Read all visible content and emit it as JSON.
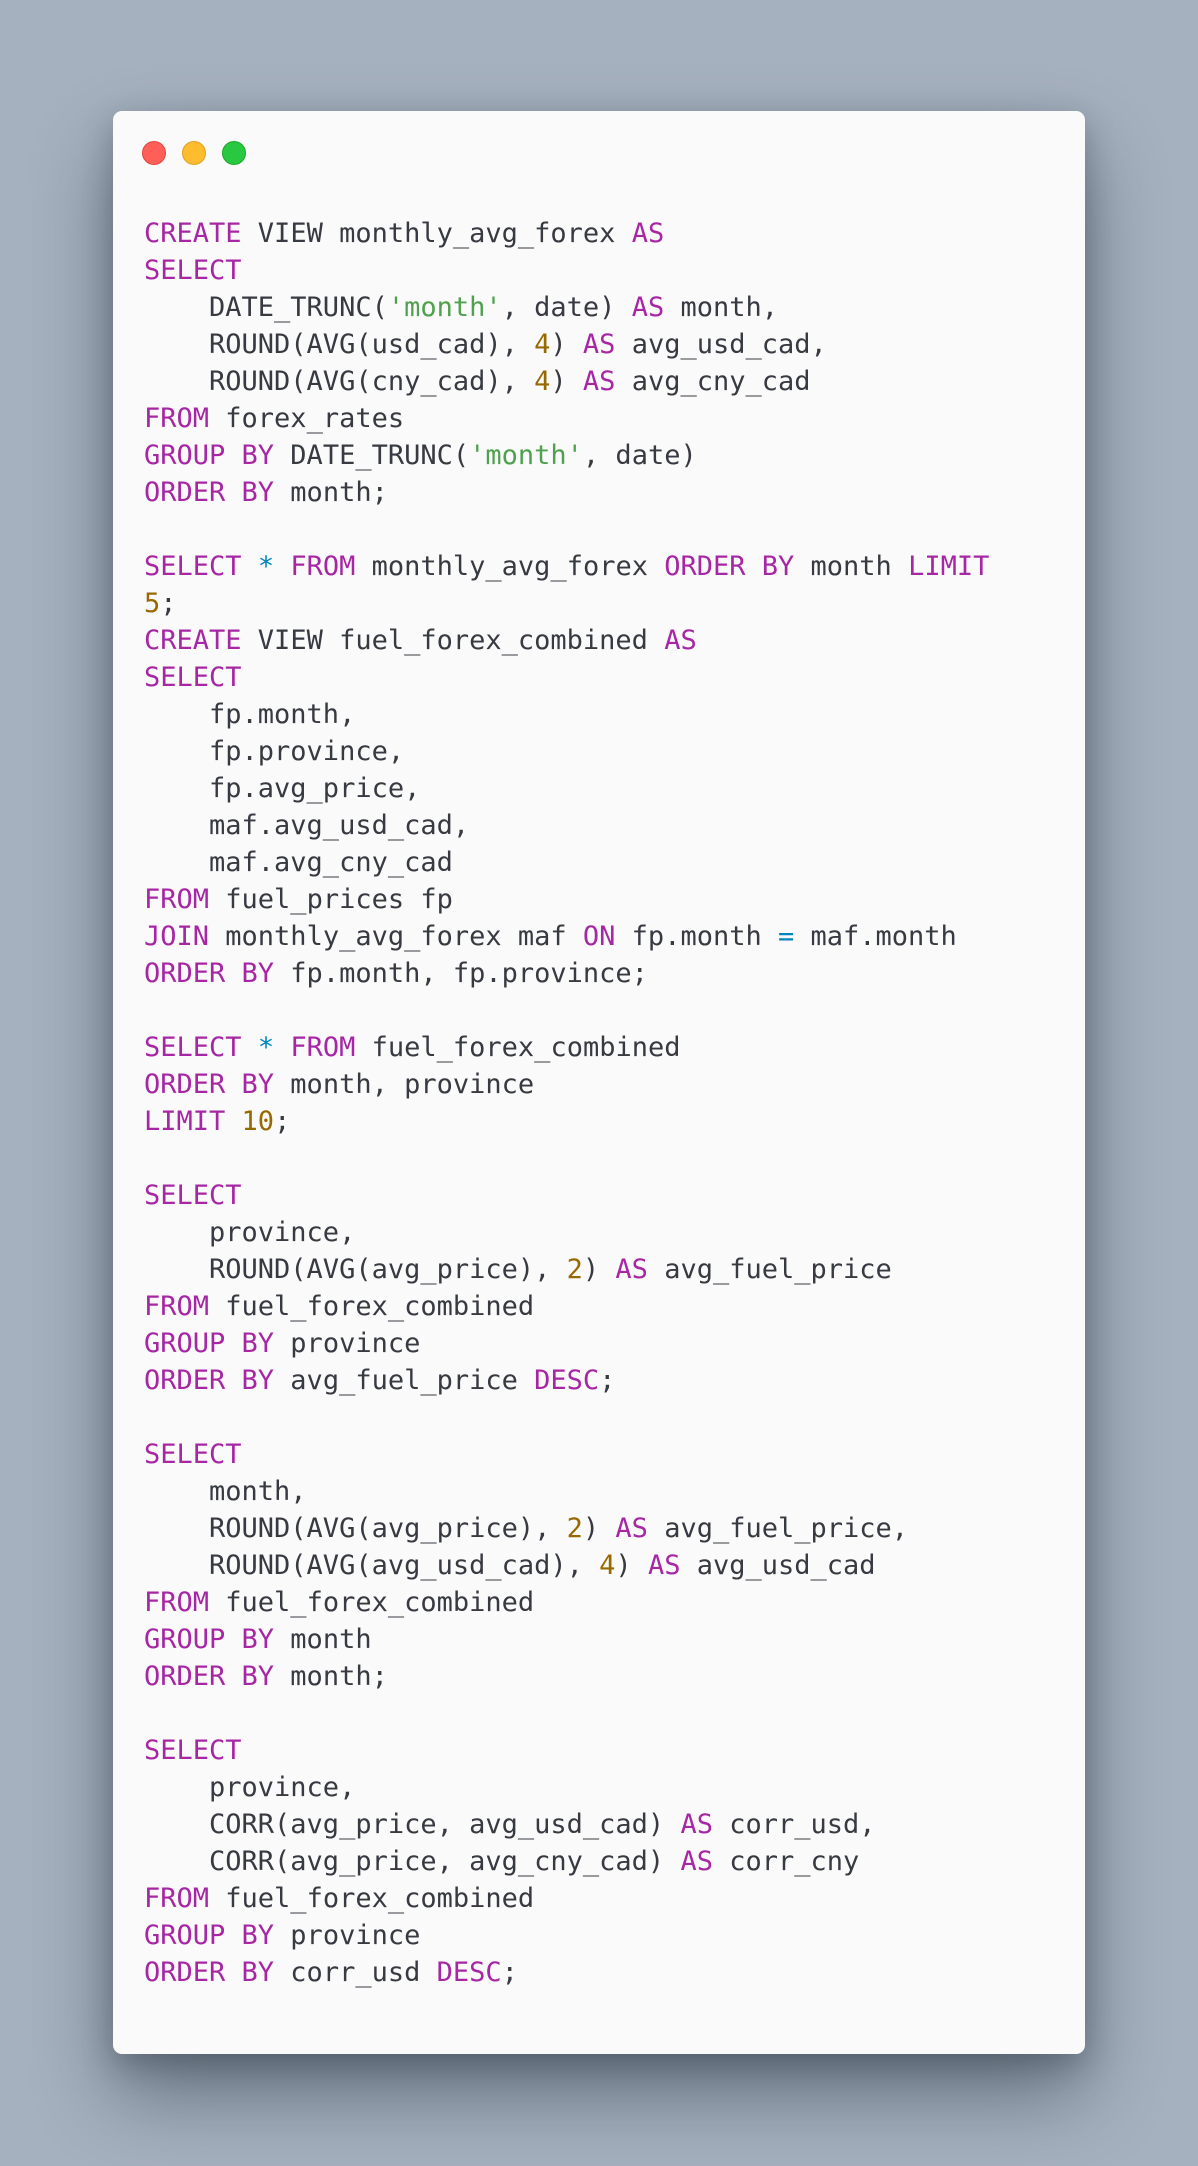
{
  "window": {
    "controls": {
      "close": "red-dot-icon",
      "minimize": "yellow-dot-icon",
      "zoom": "green-dot-icon"
    }
  },
  "theme": {
    "background": "#a6b1bf",
    "panel": "#fafafa",
    "keyword": "#a626a4",
    "string": "#50a14f",
    "number": "#986801",
    "operator": "#0184bc",
    "text": "#383a42"
  },
  "code": {
    "language": "SQL",
    "lines": [
      [
        [
          "kw",
          "CREATE"
        ],
        [
          "id",
          " VIEW monthly_avg_forex "
        ],
        [
          "kw",
          "AS"
        ]
      ],
      [
        [
          "kw",
          "SELECT"
        ]
      ],
      [
        [
          "id",
          "    DATE_TRUNC("
        ],
        [
          "str",
          "'month'"
        ],
        [
          "id",
          ", date) "
        ],
        [
          "kw",
          "AS"
        ],
        [
          "id",
          " month,"
        ]
      ],
      [
        [
          "id",
          "    ROUND(AVG(usd_cad), "
        ],
        [
          "num",
          "4"
        ],
        [
          "id",
          ") "
        ],
        [
          "kw",
          "AS"
        ],
        [
          "id",
          " avg_usd_cad,"
        ]
      ],
      [
        [
          "id",
          "    ROUND(AVG(cny_cad), "
        ],
        [
          "num",
          "4"
        ],
        [
          "id",
          ") "
        ],
        [
          "kw",
          "AS"
        ],
        [
          "id",
          " avg_cny_cad"
        ]
      ],
      [
        [
          "kw",
          "FROM"
        ],
        [
          "id",
          " forex_rates"
        ]
      ],
      [
        [
          "kw",
          "GROUP BY"
        ],
        [
          "id",
          " DATE_TRUNC("
        ],
        [
          "str",
          "'month'"
        ],
        [
          "id",
          ", date)"
        ]
      ],
      [
        [
          "kw",
          "ORDER BY"
        ],
        [
          "id",
          " month;"
        ]
      ],
      [],
      [
        [
          "kw",
          "SELECT"
        ],
        [
          "id",
          " "
        ],
        [
          "op",
          "*"
        ],
        [
          "id",
          " "
        ],
        [
          "kw",
          "FROM"
        ],
        [
          "id",
          " monthly_avg_forex "
        ],
        [
          "kw",
          "ORDER BY"
        ],
        [
          "id",
          " month "
        ],
        [
          "kw",
          "LIMIT"
        ]
      ],
      [
        [
          "num",
          "5"
        ],
        [
          "id",
          ";"
        ]
      ],
      [
        [
          "kw",
          "CREATE"
        ],
        [
          "id",
          " VIEW fuel_forex_combined "
        ],
        [
          "kw",
          "AS"
        ]
      ],
      [
        [
          "kw",
          "SELECT"
        ]
      ],
      [
        [
          "id",
          "    fp.month,"
        ]
      ],
      [
        [
          "id",
          "    fp.province,"
        ]
      ],
      [
        [
          "id",
          "    fp.avg_price,"
        ]
      ],
      [
        [
          "id",
          "    maf.avg_usd_cad,"
        ]
      ],
      [
        [
          "id",
          "    maf.avg_cny_cad"
        ]
      ],
      [
        [
          "kw",
          "FROM"
        ],
        [
          "id",
          " fuel_prices fp"
        ]
      ],
      [
        [
          "kw",
          "JOIN"
        ],
        [
          "id",
          " monthly_avg_forex maf "
        ],
        [
          "kw",
          "ON"
        ],
        [
          "id",
          " fp.month "
        ],
        [
          "op",
          "="
        ],
        [
          "id",
          " maf.month"
        ]
      ],
      [
        [
          "kw",
          "ORDER BY"
        ],
        [
          "id",
          " fp.month, fp.province;"
        ]
      ],
      [],
      [
        [
          "kw",
          "SELECT"
        ],
        [
          "id",
          " "
        ],
        [
          "op",
          "*"
        ],
        [
          "id",
          " "
        ],
        [
          "kw",
          "FROM"
        ],
        [
          "id",
          " fuel_forex_combined"
        ]
      ],
      [
        [
          "kw",
          "ORDER BY"
        ],
        [
          "id",
          " month, province"
        ]
      ],
      [
        [
          "kw",
          "LIMIT"
        ],
        [
          "id",
          " "
        ],
        [
          "num",
          "10"
        ],
        [
          "id",
          ";"
        ]
      ],
      [],
      [
        [
          "kw",
          "SELECT"
        ]
      ],
      [
        [
          "id",
          "    province,"
        ]
      ],
      [
        [
          "id",
          "    ROUND(AVG(avg_price), "
        ],
        [
          "num",
          "2"
        ],
        [
          "id",
          ") "
        ],
        [
          "kw",
          "AS"
        ],
        [
          "id",
          " avg_fuel_price"
        ]
      ],
      [
        [
          "kw",
          "FROM"
        ],
        [
          "id",
          " fuel_forex_combined"
        ]
      ],
      [
        [
          "kw",
          "GROUP BY"
        ],
        [
          "id",
          " province"
        ]
      ],
      [
        [
          "kw",
          "ORDER BY"
        ],
        [
          "id",
          " avg_fuel_price "
        ],
        [
          "kw",
          "DESC"
        ],
        [
          "id",
          ";"
        ]
      ],
      [],
      [
        [
          "kw",
          "SELECT"
        ]
      ],
      [
        [
          "id",
          "    month,"
        ]
      ],
      [
        [
          "id",
          "    ROUND(AVG(avg_price), "
        ],
        [
          "num",
          "2"
        ],
        [
          "id",
          ") "
        ],
        [
          "kw",
          "AS"
        ],
        [
          "id",
          " avg_fuel_price,"
        ]
      ],
      [
        [
          "id",
          "    ROUND(AVG(avg_usd_cad), "
        ],
        [
          "num",
          "4"
        ],
        [
          "id",
          ") "
        ],
        [
          "kw",
          "AS"
        ],
        [
          "id",
          " avg_usd_cad"
        ]
      ],
      [
        [
          "kw",
          "FROM"
        ],
        [
          "id",
          " fuel_forex_combined"
        ]
      ],
      [
        [
          "kw",
          "GROUP BY"
        ],
        [
          "id",
          " month"
        ]
      ],
      [
        [
          "kw",
          "ORDER BY"
        ],
        [
          "id",
          " month;"
        ]
      ],
      [],
      [
        [
          "kw",
          "SELECT"
        ]
      ],
      [
        [
          "id",
          "    province,"
        ]
      ],
      [
        [
          "id",
          "    CORR(avg_price, avg_usd_cad) "
        ],
        [
          "kw",
          "AS"
        ],
        [
          "id",
          " corr_usd,"
        ]
      ],
      [
        [
          "id",
          "    CORR(avg_price, avg_cny_cad) "
        ],
        [
          "kw",
          "AS"
        ],
        [
          "id",
          " corr_cny"
        ]
      ],
      [
        [
          "kw",
          "FROM"
        ],
        [
          "id",
          " fuel_forex_combined"
        ]
      ],
      [
        [
          "kw",
          "GROUP BY"
        ],
        [
          "id",
          " province"
        ]
      ],
      [
        [
          "kw",
          "ORDER BY"
        ],
        [
          "id",
          " corr_usd "
        ],
        [
          "kw",
          "DESC"
        ],
        [
          "id",
          ";"
        ]
      ]
    ]
  }
}
